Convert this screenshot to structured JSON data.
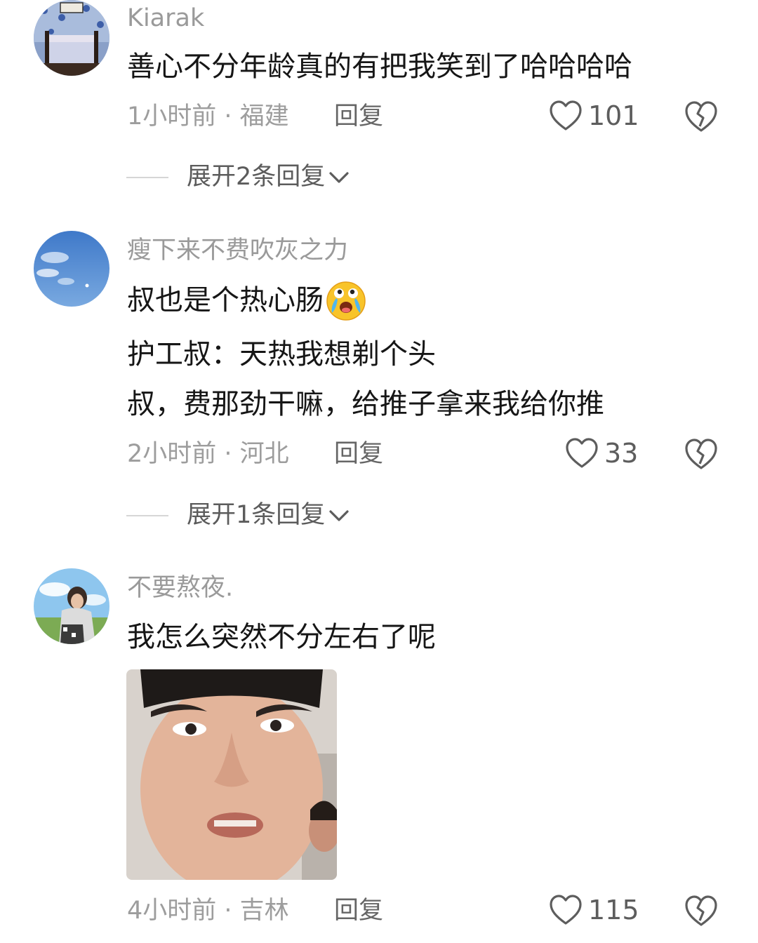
{
  "comments": [
    {
      "username": "Kiarak",
      "lines": [
        "善心不分年龄真的有把我笑到了哈哈哈哈"
      ],
      "time_location": "1小时前 · 福建",
      "reply_label": "回复",
      "like_count": "101",
      "expand_label": "展开2条回复"
    },
    {
      "username": "瘦下来不费吹灰之力",
      "lines": [
        "叔也是个热心肠",
        "护工叔：天热我想剃个头",
        "叔，费那劲干嘛，给推子拿来我给你推"
      ],
      "time_location": "2小时前 · 河北",
      "reply_label": "回复",
      "like_count": "33",
      "expand_label": "展开1条回复"
    },
    {
      "username": "不要熬夜.",
      "lines": [
        "我怎么突然不分左右了呢"
      ],
      "time_location": "4小时前 · 吉林",
      "reply_label": "回复",
      "like_count": "115"
    }
  ],
  "icons": {
    "like": "heart-outline-icon",
    "dislike": "broken-heart-icon",
    "expand": "chevron-down-icon",
    "emoji": "crying-laughing-emoji-icon"
  },
  "colors": {
    "username": "#9a9a9a",
    "text": "#161616",
    "meta": "#9d9d9d"
  }
}
